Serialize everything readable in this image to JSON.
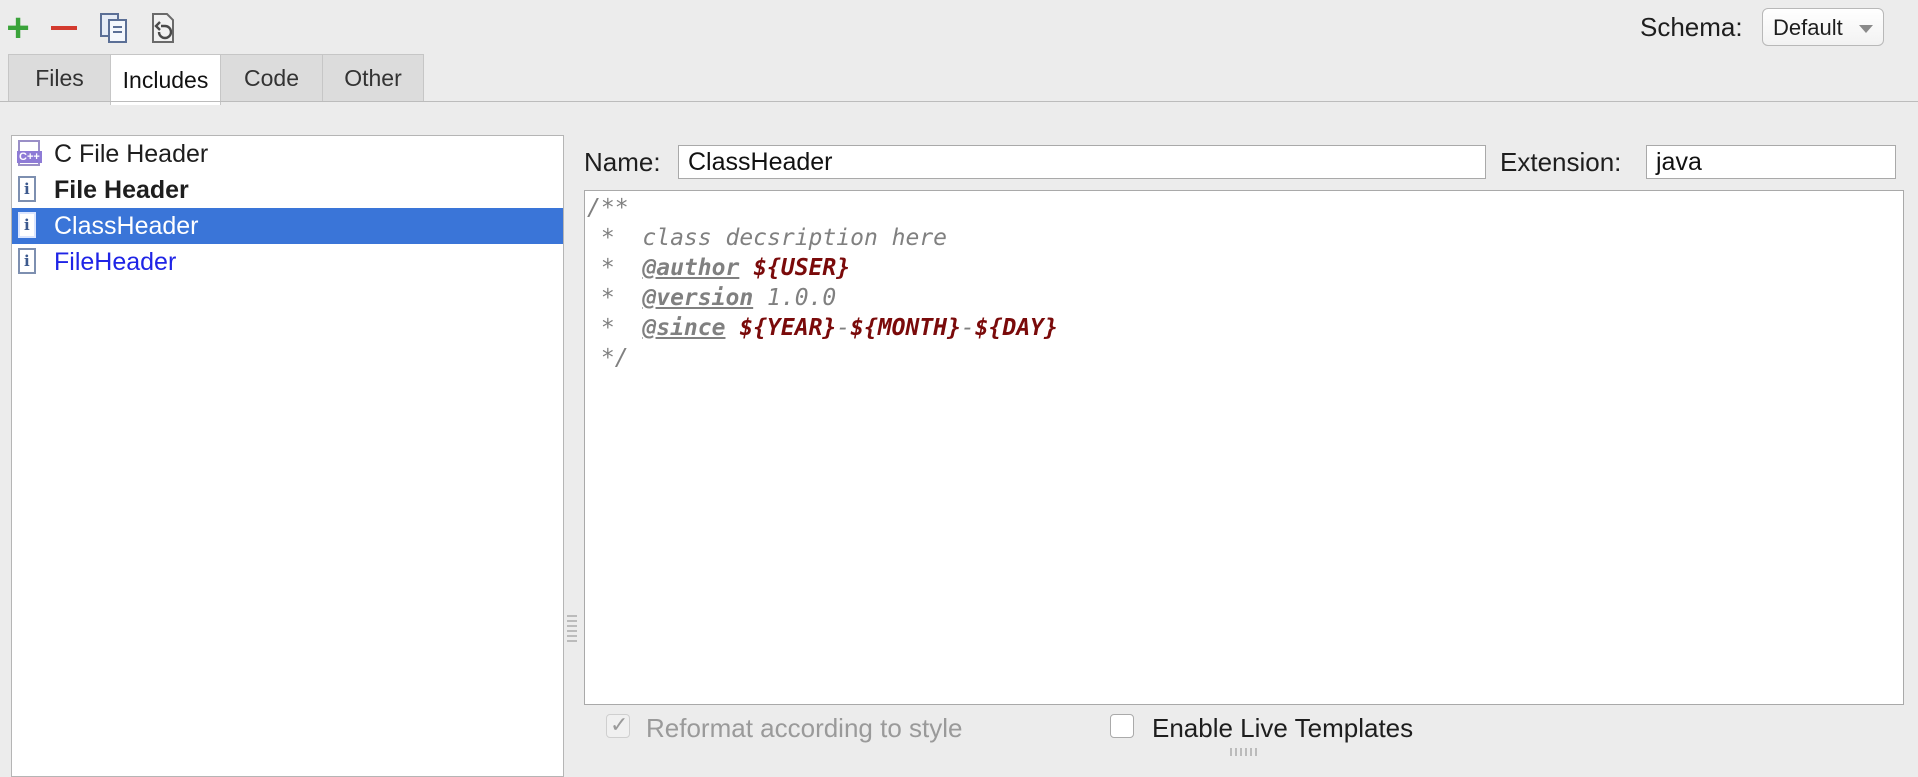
{
  "toolbar": {
    "add_icon": "plus-icon",
    "remove_icon": "minus-icon",
    "copy_icon": "copy-icon",
    "reset_icon": "reset-icon",
    "schema_label": "Schema:",
    "schema_value": "Default"
  },
  "tabs": [
    {
      "label": "Files",
      "active": false
    },
    {
      "label": "Includes",
      "active": true
    },
    {
      "label": "Code",
      "active": false
    },
    {
      "label": "Other",
      "active": false
    }
  ],
  "templates": [
    {
      "label": "C File Header",
      "icon": "cpp-file-icon",
      "style": "normal"
    },
    {
      "label": "File Header",
      "icon": "java-file-icon",
      "style": "bold"
    },
    {
      "label": "ClassHeader",
      "icon": "java-file-icon",
      "style": "selected"
    },
    {
      "label": "FileHeader",
      "icon": "java-file-icon",
      "style": "blue"
    }
  ],
  "editor": {
    "name_label": "Name:",
    "name_value": "ClassHeader",
    "extension_label": "Extension:",
    "extension_value": "java",
    "code": {
      "l1": "/**",
      "l2_prefix": " *  ",
      "l2_text": "class decsription here",
      "l3_prefix": " *  ",
      "l3_tag": "@author",
      "l3_var": "${USER}",
      "l4_prefix": " *  ",
      "l4_tag": "@version",
      "l4_text": "1.0.0",
      "l5_prefix": " *  ",
      "l5_tag": "@since",
      "l5_var1": "${YEAR}",
      "l5_sep1": "-",
      "l5_var2": "${MONTH}",
      "l5_sep2": "-",
      "l5_var3": "${DAY}",
      "l6": " */"
    }
  },
  "options": {
    "reformat_label": "Reformat according to style",
    "reformat_checked": true,
    "live_templates_label": "Enable Live Templates",
    "live_templates_checked": false
  },
  "colors": {
    "selection": "#3a75d8",
    "variable": "#7a0a0a",
    "link_blue": "#1f24e6"
  }
}
